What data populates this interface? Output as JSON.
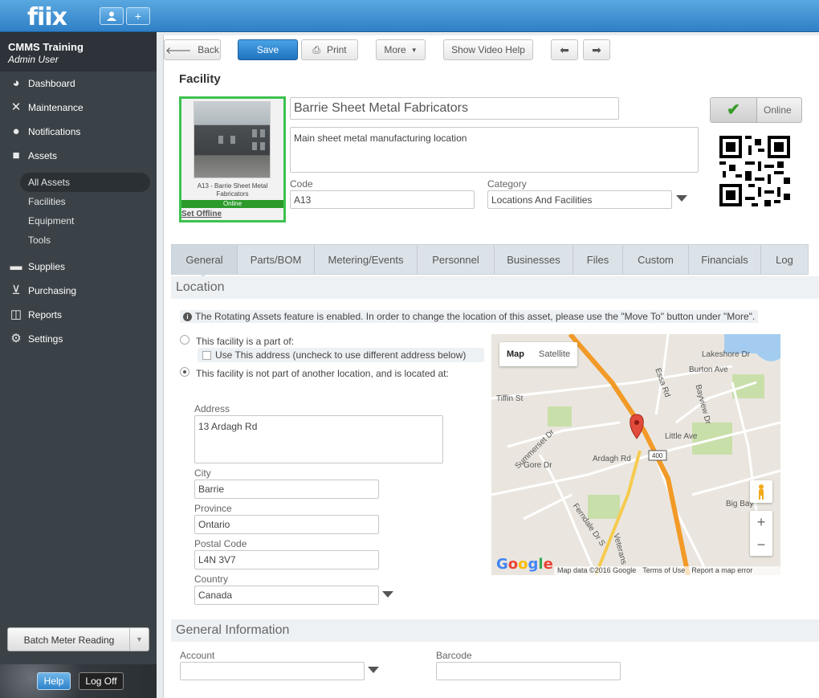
{
  "app": {
    "logo": "fiix"
  },
  "topbar": {
    "user_btn_icon": "user-icon",
    "add_btn": "+"
  },
  "sidebar": {
    "org": "CMMS Training",
    "role": "Admin User",
    "items": [
      {
        "label": "Dashboard",
        "icon": "dashboard-icon"
      },
      {
        "label": "Maintenance",
        "icon": "wrench-icon"
      },
      {
        "label": "Notifications",
        "icon": "speech-bubble-icon"
      },
      {
        "label": "Assets",
        "icon": "boxes-icon"
      }
    ],
    "sub_items": [
      "All Assets",
      "Facilities",
      "Equipment",
      "Tools"
    ],
    "items2": [
      {
        "label": "Supplies",
        "icon": "truck-icon"
      },
      {
        "label": "Purchasing",
        "icon": "cart-icon"
      },
      {
        "label": "Reports",
        "icon": "chart-icon"
      },
      {
        "label": "Settings",
        "icon": "gear-icon"
      }
    ],
    "batch_button": "Batch Meter Reading",
    "help": "Help",
    "logoff": "Log Off"
  },
  "toolbar": {
    "back": "Back",
    "save": "Save",
    "print": "Print",
    "more": "More",
    "video_help": "Show Video Help"
  },
  "facility": {
    "section_title": "Facility",
    "photo_caption": "A13 - Barrie Sheet Metal Fabricators",
    "photo_status": "Online",
    "set_offline": "Set Offline",
    "name": "Barrie Sheet Metal Fabricators",
    "description": "Main sheet metal manufacturing location",
    "code_label": "Code",
    "code": "A13",
    "category_label": "Category",
    "category": "Locations And Facilities",
    "online_label": "Online"
  },
  "tabs": [
    "General",
    "Parts/BOM",
    "Metering/Events",
    "Personnel",
    "Businesses",
    "Files",
    "Custom",
    "Financials",
    "Log"
  ],
  "location": {
    "header": "Location",
    "info": "The Rotating Assets feature is enabled. In order to change the location of this asset, please use the \"Move To\" button under \"More\".",
    "opt_part_of": "This facility is a part of:",
    "use_address": "Use This address (uncheck to use different address below)",
    "opt_not_part": "This facility is not part of another location, and is located at:",
    "address_label": "Address",
    "address": "13 Ardagh Rd",
    "city_label": "City",
    "city": "Barrie",
    "province_label": "Province",
    "province": "Ontario",
    "postal_label": "Postal Code",
    "postal": "L4N 3V7",
    "country_label": "Country",
    "country": "Canada"
  },
  "map": {
    "type_map": "Map",
    "type_satellite": "Satellite",
    "labels": [
      "Lakeshore Dr",
      "Burton Ave",
      "Tiffin St",
      "Little Ave",
      "Ardagh Rd",
      "Gore Dr",
      "Summerset Dr",
      "Ferndale Dr S",
      "Veterans",
      "Big Bay",
      "Essa Rd",
      "Bayview Dr",
      "400"
    ],
    "google": "Google",
    "data": "Map data ©2016 Google",
    "terms": "Terms of Use",
    "report": "Report a map error"
  },
  "general_info": {
    "header": "General Information",
    "account_label": "Account",
    "account": "",
    "barcode_label": "Barcode",
    "barcode": ""
  },
  "colors": {
    "accent": "#2f7fc6",
    "sidebar": "#3b4247",
    "online_green": "#3cc24f"
  }
}
